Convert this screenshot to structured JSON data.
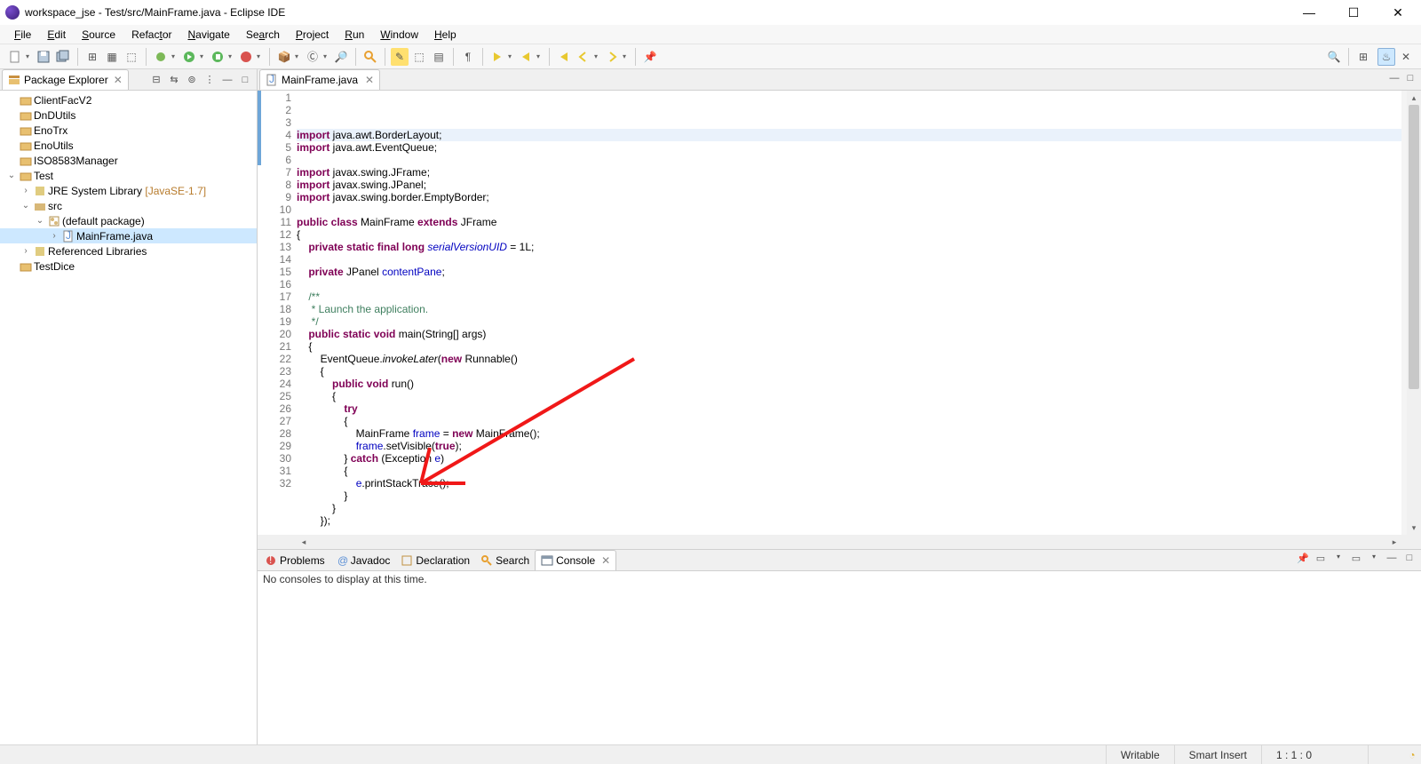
{
  "window": {
    "title": "workspace_jse - Test/src/MainFrame.java - Eclipse IDE"
  },
  "menu": [
    "File",
    "Edit",
    "Source",
    "Refactor",
    "Navigate",
    "Search",
    "Project",
    "Run",
    "Window",
    "Help"
  ],
  "packageExplorer": {
    "title": "Package Explorer",
    "projects": [
      {
        "name": "ClientFacV2"
      },
      {
        "name": "DnDUtils"
      },
      {
        "name": "EnoTrx"
      },
      {
        "name": "EnoUtils"
      },
      {
        "name": "ISO8583Manager"
      },
      {
        "name": "Test",
        "open": true,
        "children": [
          {
            "name": "JRE System Library",
            "deco": "[JavaSE-1.7]"
          },
          {
            "name": "src",
            "open": true,
            "children": [
              {
                "name": "(default package)",
                "open": true,
                "children": [
                  {
                    "name": "MainFrame.java",
                    "selected": true
                  }
                ]
              }
            ]
          },
          {
            "name": "Referenced Libraries"
          }
        ]
      },
      {
        "name": "TestDice"
      }
    ]
  },
  "editor": {
    "tab": "MainFrame.java",
    "lines": [
      {
        "n": 1,
        "tokens": [
          {
            "t": "import ",
            "c": "kw"
          },
          {
            "t": "java.awt.BorderLayout;"
          }
        ]
      },
      {
        "n": 2,
        "tokens": [
          {
            "t": "import ",
            "c": "kw"
          },
          {
            "t": "java.awt.EventQueue;"
          }
        ]
      },
      {
        "n": 3,
        "tokens": []
      },
      {
        "n": 4,
        "tokens": [
          {
            "t": "import ",
            "c": "kw"
          },
          {
            "t": "javax.swing.JFrame;"
          }
        ]
      },
      {
        "n": 5,
        "tokens": [
          {
            "t": "import ",
            "c": "kw"
          },
          {
            "t": "javax.swing.JPanel;"
          }
        ]
      },
      {
        "n": 6,
        "tokens": [
          {
            "t": "import ",
            "c": "kw"
          },
          {
            "t": "javax.swing.border.EmptyBorder;"
          }
        ]
      },
      {
        "n": 7,
        "tokens": []
      },
      {
        "n": 8,
        "tokens": [
          {
            "t": "public class ",
            "c": "kw"
          },
          {
            "t": "MainFrame "
          },
          {
            "t": "extends ",
            "c": "kw"
          },
          {
            "t": "JFrame"
          }
        ]
      },
      {
        "n": 9,
        "tokens": [
          {
            "t": "{"
          }
        ]
      },
      {
        "n": 10,
        "tokens": [
          {
            "t": "    "
          },
          {
            "t": "private static final long ",
            "c": "kw"
          },
          {
            "t": "serialVersionUID",
            "c": "sfield"
          },
          {
            "t": " = 1L;"
          }
        ]
      },
      {
        "n": 11,
        "tokens": []
      },
      {
        "n": 12,
        "tokens": [
          {
            "t": "    "
          },
          {
            "t": "private ",
            "c": "kw"
          },
          {
            "t": "JPanel "
          },
          {
            "t": "contentPane",
            "c": "field"
          },
          {
            "t": ";"
          }
        ]
      },
      {
        "n": 13,
        "tokens": []
      },
      {
        "n": 14,
        "tokens": [
          {
            "t": "    "
          },
          {
            "t": "/**",
            "c": "cmt"
          }
        ]
      },
      {
        "n": 15,
        "tokens": [
          {
            "t": "     * Launch the application.",
            "c": "cmt"
          }
        ]
      },
      {
        "n": 16,
        "tokens": [
          {
            "t": "     */",
            "c": "cmt"
          }
        ]
      },
      {
        "n": 17,
        "tokens": [
          {
            "t": "    "
          },
          {
            "t": "public static void ",
            "c": "kw"
          },
          {
            "t": "main(String[] args)"
          }
        ]
      },
      {
        "n": 18,
        "tokens": [
          {
            "t": "    {"
          }
        ]
      },
      {
        "n": 19,
        "tokens": [
          {
            "t": "        EventQueue."
          },
          {
            "t": "invokeLater",
            "c": "method"
          },
          {
            "t": "("
          },
          {
            "t": "new ",
            "c": "kw"
          },
          {
            "t": "Runnable()"
          }
        ]
      },
      {
        "n": 20,
        "tokens": [
          {
            "t": "        {"
          }
        ]
      },
      {
        "n": 21,
        "tokens": [
          {
            "t": "            "
          },
          {
            "t": "public void ",
            "c": "kw"
          },
          {
            "t": "run()"
          }
        ]
      },
      {
        "n": 22,
        "tokens": [
          {
            "t": "            {"
          }
        ]
      },
      {
        "n": 23,
        "tokens": [
          {
            "t": "                "
          },
          {
            "t": "try",
            "c": "kw"
          }
        ]
      },
      {
        "n": 24,
        "tokens": [
          {
            "t": "                {"
          }
        ]
      },
      {
        "n": 25,
        "tokens": [
          {
            "t": "                    MainFrame "
          },
          {
            "t": "frame",
            "c": "field"
          },
          {
            "t": " = "
          },
          {
            "t": "new ",
            "c": "kw"
          },
          {
            "t": "MainFrame();"
          }
        ]
      },
      {
        "n": 26,
        "tokens": [
          {
            "t": "                    "
          },
          {
            "t": "frame",
            "c": "field"
          },
          {
            "t": ".setVisible("
          },
          {
            "t": "true",
            "c": "kw"
          },
          {
            "t": ");"
          }
        ]
      },
      {
        "n": 27,
        "tokens": [
          {
            "t": "                } "
          },
          {
            "t": "catch ",
            "c": "kw"
          },
          {
            "t": "(Exception "
          },
          {
            "t": "e",
            "c": "field"
          },
          {
            "t": ")"
          }
        ]
      },
      {
        "n": 28,
        "tokens": [
          {
            "t": "                {"
          }
        ]
      },
      {
        "n": 29,
        "tokens": [
          {
            "t": "                    "
          },
          {
            "t": "e",
            "c": "field"
          },
          {
            "t": ".printStackTrace();"
          }
        ]
      },
      {
        "n": 30,
        "tokens": [
          {
            "t": "                }"
          }
        ]
      },
      {
        "n": 31,
        "tokens": [
          {
            "t": "            }"
          }
        ]
      },
      {
        "n": 32,
        "tokens": [
          {
            "t": "        });"
          }
        ]
      }
    ]
  },
  "bottomTabs": [
    {
      "label": "Problems"
    },
    {
      "label": "Javadoc"
    },
    {
      "label": "Declaration"
    },
    {
      "label": "Search"
    },
    {
      "label": "Console",
      "active": true
    }
  ],
  "console": {
    "empty": "No consoles to display at this time."
  },
  "status": {
    "writable": "Writable",
    "insert": "Smart Insert",
    "pos": "1 : 1 : 0"
  }
}
